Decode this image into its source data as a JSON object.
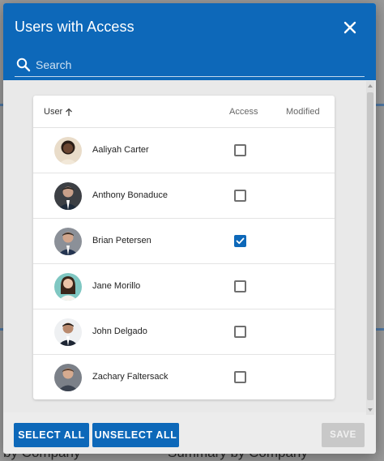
{
  "colors": {
    "primary": "#0d68b9",
    "header_bg": "#0d68b9",
    "disabled_bg": "#c8c8c8",
    "overlay": "#9a9a9a"
  },
  "background": {
    "fragment_left": "by Company",
    "fragment_right": "Summary by Company"
  },
  "dialog": {
    "title": "Users with Access",
    "close_icon": "close-icon",
    "search": {
      "placeholder": "Search",
      "value": "",
      "icon": "search-icon"
    },
    "table": {
      "columns": {
        "user": "User",
        "access": "Access",
        "modified": "Modified"
      },
      "sort": "ascending",
      "rows": [
        {
          "name": "Aaliyah Carter",
          "access": false,
          "modified": "",
          "avatar": "avatar-aaliyah"
        },
        {
          "name": "Anthony Bonaduce",
          "access": false,
          "modified": "",
          "avatar": "avatar-anthony"
        },
        {
          "name": "Brian Petersen",
          "access": true,
          "modified": "",
          "avatar": "avatar-brian"
        },
        {
          "name": "Jane Morillo",
          "access": false,
          "modified": "",
          "avatar": "avatar-jane"
        },
        {
          "name": "John Delgado",
          "access": false,
          "modified": "",
          "avatar": "avatar-john"
        },
        {
          "name": "Zachary Faltersack",
          "access": false,
          "modified": "",
          "avatar": "avatar-zachary"
        }
      ]
    },
    "buttons": {
      "select_all": "SELECT ALL",
      "unselect_all": "UNSELECT ALL",
      "save": "SAVE",
      "save_disabled": true
    }
  }
}
